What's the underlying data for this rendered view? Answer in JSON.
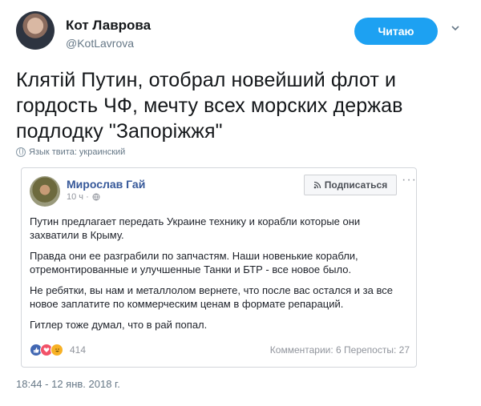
{
  "tweet": {
    "author_name": "Кот Лаврова",
    "author_handle": "@KotLavrova",
    "follow_label": "Читаю",
    "text": "Клятій Путин, отобрал новейший флот и гордость ЧФ, мечту всех морских держав подлодку \"Запоріжжя\"",
    "language_note": "Язык твита: украинский",
    "timestamp": "18:44 - 12 янв. 2018 г."
  },
  "embedded_post": {
    "author": "Мирослав Гай",
    "time": "10 ч ·",
    "subscribe_label": "Подписаться",
    "more_label": "···",
    "paragraphs": [
      "Путин предлагает передать Украине технику и корабли которые они захватили в Крыму.",
      "Правда они ее разграбили по запчастям. Наши новенькие корабли, отремонтированные и улучшенные Танки и БТР - все новое было.",
      "Не ребятки, вы нам и металлолом вернете, что после вас остался и за все новое заплатите по коммерческим ценам в формате репараций.",
      "Гитлер тоже думал, что в рай попал."
    ],
    "reactions_count": "414",
    "comments": "Комментарии: 6",
    "shares": "Перепосты: 27",
    "stats_line": "Комментарии: 6  Перепосты: 27"
  }
}
